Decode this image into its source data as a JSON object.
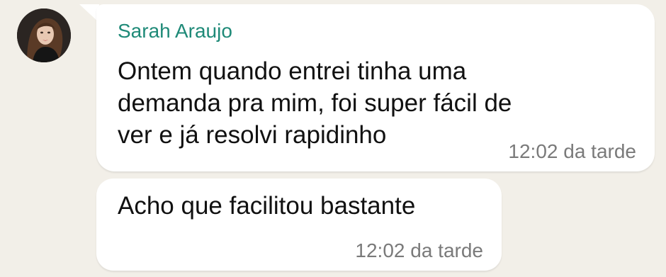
{
  "messages": [
    {
      "sender": "Sarah Araujo",
      "text": "Ontem quando entrei tinha uma\ndemanda pra mim, foi super fácil de\nver e já resolvi rapidinho",
      "time": "12:02 da tarde"
    },
    {
      "text": "Acho que facilitou bastante",
      "time": "12:02 da tarde"
    }
  ],
  "colors": {
    "background": "#f2efe8",
    "bubble": "#ffffff",
    "sender_name": "#1f8a78",
    "timestamp": "#7a7a7a"
  },
  "icons": {
    "avatar": "sender-avatar-photo"
  }
}
